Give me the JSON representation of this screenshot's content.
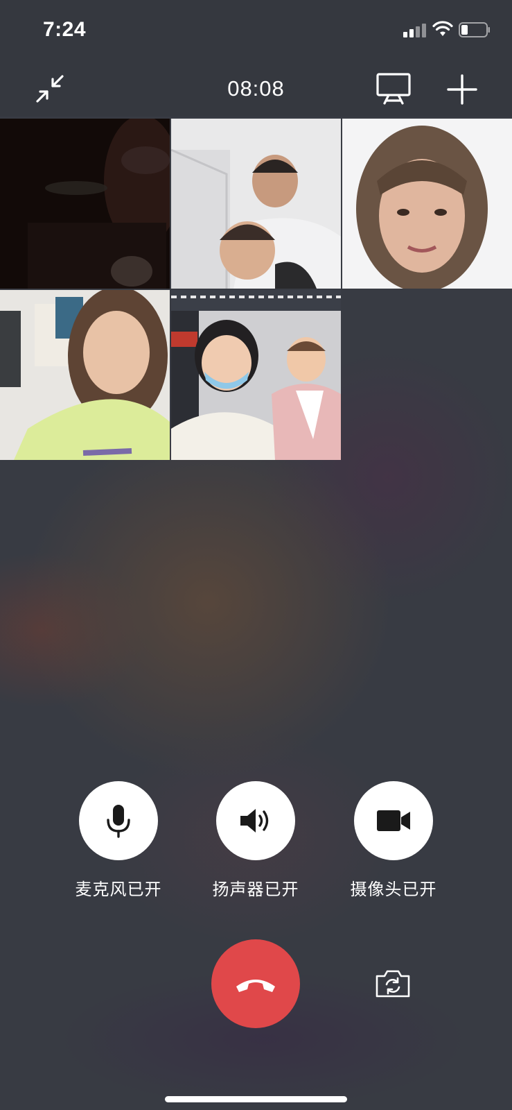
{
  "status_bar": {
    "time": "7:24",
    "icons": [
      "cellular-signal-icon",
      "wifi-icon",
      "battery-icon"
    ]
  },
  "top_bar": {
    "minimize_icon": "minimize-arrows-icon",
    "call_duration": "08:08",
    "screen_share_icon": "screen-share-icon",
    "add_icon": "plus-icon"
  },
  "video_grid": {
    "participants": [
      {
        "id": 1,
        "description_icon": "video-feed"
      },
      {
        "id": 2,
        "description_icon": "video-feed"
      },
      {
        "id": 3,
        "description_icon": "video-feed"
      },
      {
        "id": 4,
        "description_icon": "video-feed"
      },
      {
        "id": 5,
        "description_icon": "video-feed"
      }
    ]
  },
  "controls": {
    "microphone": {
      "label": "麦克风已开",
      "icon": "microphone-icon"
    },
    "speaker": {
      "label": "扬声器已开",
      "icon": "speaker-icon"
    },
    "camera": {
      "label": "摄像头已开",
      "icon": "video-camera-icon"
    }
  },
  "bottom": {
    "hangup_icon": "hang-up-icon",
    "hangup_color": "#e0484a",
    "switch_camera_icon": "switch-camera-icon"
  },
  "colors": {
    "background": "#35383f",
    "text": "#ffffff",
    "hangup": "#e0484a"
  }
}
